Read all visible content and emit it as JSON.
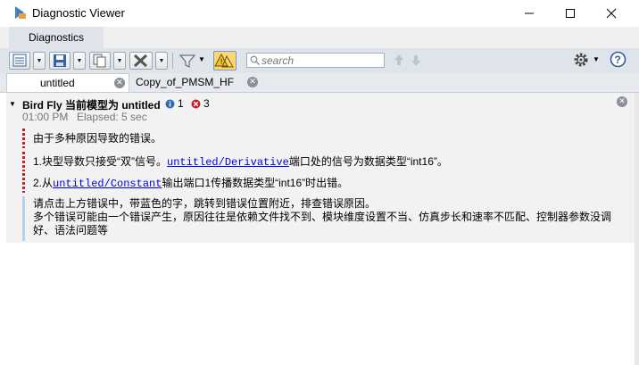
{
  "window": {
    "title": "Diagnostic Viewer",
    "controls": [
      "minimize",
      "maximize",
      "close"
    ]
  },
  "ribbon": {
    "tab_label": "Diagnostics"
  },
  "toolbar": {
    "search": {
      "placeholder": "search",
      "value": ""
    },
    "icons": [
      "report-view-icon",
      "save-icon",
      "copy-icon",
      "clear-icon",
      "filter-icon",
      "warnings-toggle-icon",
      "navigate-up-icon",
      "navigate-down-icon",
      "settings-gear-icon",
      "help-icon"
    ]
  },
  "doc_tabs": [
    {
      "label": "untitled",
      "active": true
    },
    {
      "label": "Copy_of_PMSM_HF",
      "active": false
    }
  ],
  "diagnostic": {
    "title": "Bird Fly 当前模型为 untitled",
    "info_count": "1",
    "error_count": "3",
    "time": "01:00 PM",
    "elapsed": "Elapsed: 5 sec",
    "messages": [
      {
        "type": "error",
        "text": "由于多种原因导致的错误。"
      },
      {
        "type": "error",
        "prefix": "1.块型导数只接受“双”信号。",
        "link": "untitled/Derivative",
        "suffix": "端口处的信号为数据类型“int16”。"
      },
      {
        "type": "error",
        "prefix": "2.从",
        "link": "untitled/Constant",
        "suffix": "输出端口1传播数据类型“int16”时出错。"
      }
    ],
    "info": {
      "line1": "请点击上方错误中，带蓝色的字，跳转到错误位置附近，排查错误原因。",
      "line2": "多个错误可能由一个错误产生，原因往往是依赖文件找不到、模块维度设置不当、仿真步长和速率不匹配、控制器参数没调",
      "line3": "好、语法问题等"
    }
  },
  "colors": {
    "link": "#0000ee",
    "error": "#c8202a",
    "info": "#2e6db4",
    "toolbar_bg": "#dfe4ea"
  }
}
